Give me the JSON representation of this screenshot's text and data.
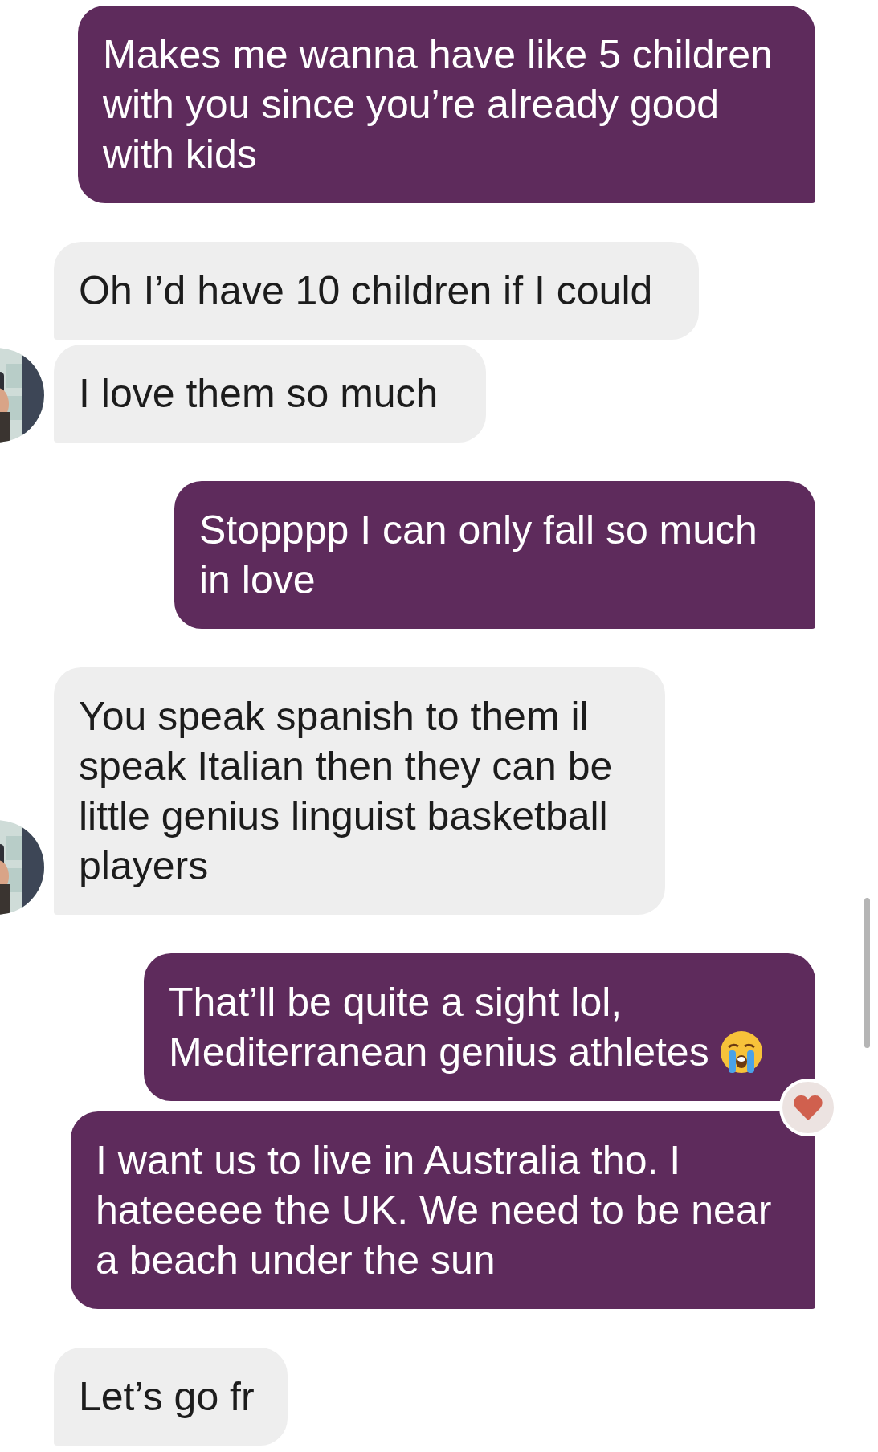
{
  "messages": [
    {
      "kind": "sent",
      "text": "Makes me wanna have like 5 children with you since you’re already good with kids",
      "reacted": false
    },
    {
      "kind": "received",
      "text": "Oh I’d have 10 children if I could",
      "avatar": false
    },
    {
      "kind": "received",
      "text": "I love them so much",
      "avatar": true
    },
    {
      "kind": "sent",
      "text": "Stopppp I can only fall so much in love",
      "reacted": false
    },
    {
      "kind": "received",
      "text": "You speak spanish to them il speak Italian then they can be little genius linguist basketball players",
      "avatar": true
    },
    {
      "kind": "sent",
      "text": "That’ll be quite a sight lol, Mediterranean genius athletes",
      "reacted": true,
      "trailing_icon": true
    },
    {
      "kind": "sent",
      "text": "I want us to live in Australia tho. I hateeeee the UK. We need to be near a beach under the sun",
      "reacted": false
    },
    {
      "kind": "received",
      "text": "Let’s go fr",
      "avatar": false
    }
  ]
}
